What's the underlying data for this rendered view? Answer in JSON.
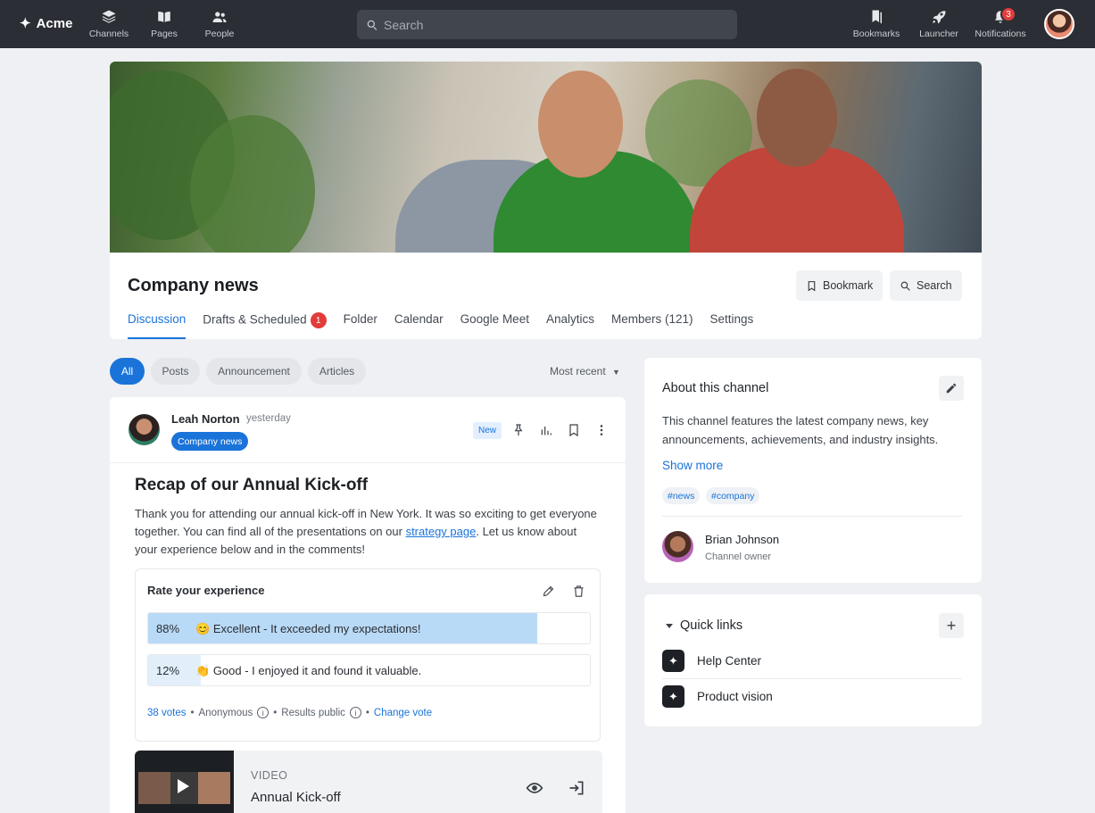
{
  "topbar": {
    "brand": "Acme",
    "nav": [
      {
        "label": "Channels",
        "icon": "layers-icon"
      },
      {
        "label": "Pages",
        "icon": "book-icon"
      },
      {
        "label": "People",
        "icon": "people-icon"
      }
    ],
    "search_placeholder": "Search",
    "right": [
      {
        "label": "Bookmarks",
        "icon": "bookmarks-icon"
      },
      {
        "label": "Launcher",
        "icon": "rocket-icon"
      },
      {
        "label": "Notifications",
        "icon": "notifications-icon",
        "badge": "3"
      }
    ]
  },
  "channel": {
    "title": "Company news",
    "bookmark_label": "Bookmark",
    "search_label": "Search",
    "tabs": [
      {
        "label": "Discussion",
        "active": true
      },
      {
        "label": "Drafts & Scheduled",
        "badge": "1"
      },
      {
        "label": "Folder"
      },
      {
        "label": "Calendar"
      },
      {
        "label": "Google Meet"
      },
      {
        "label": "Analytics"
      },
      {
        "label": "Members (121)"
      },
      {
        "label": "Settings"
      }
    ]
  },
  "filters": {
    "chips": [
      "All",
      "Posts",
      "Announcement",
      "Articles"
    ],
    "sort": "Most recent"
  },
  "post": {
    "author": "Leah Norton",
    "time": "yesterday",
    "channel": "Company news",
    "new_label": "New",
    "title": "Recap of our Annual Kick-off",
    "body_before": "Thank you for attending our annual kick-off in New York. It was so exciting to get everyone together.  You can find all of the presentations on our ",
    "body_link": "strategy page",
    "body_after": ". Let us know about your experience below and in the comments!",
    "poll": {
      "title": "Rate your experience",
      "options": [
        {
          "percent": "88%",
          "share": 0.88,
          "emoji": "😊",
          "label": "Excellent - It exceeded my expectations!"
        },
        {
          "percent": "12%",
          "share": 0.12,
          "emoji": "👏",
          "label": "Good - I enjoyed it and found it valuable."
        }
      ],
      "votes": "38 votes",
      "anonymous": "Anonymous",
      "results": "Results public",
      "change_vote": "Change vote"
    },
    "video": {
      "kicker": "VIDEO",
      "title": "Annual Kick-off"
    }
  },
  "about": {
    "title": "About this channel",
    "description": "This channel features the latest company news, key announcements, achievements, and industry insights.",
    "show_more": "Show more",
    "tags": [
      "#news",
      "#company"
    ],
    "owner_name": "Brian Johnson",
    "owner_role": "Channel owner"
  },
  "quick_links": {
    "title": "Quick links",
    "items": [
      "Help Center",
      "Product vision"
    ]
  },
  "colors": {
    "accent": "#1a73d9",
    "topbar": "#2b2f35",
    "badge": "#e23b3b",
    "poll_fill": "#b9daf7"
  }
}
